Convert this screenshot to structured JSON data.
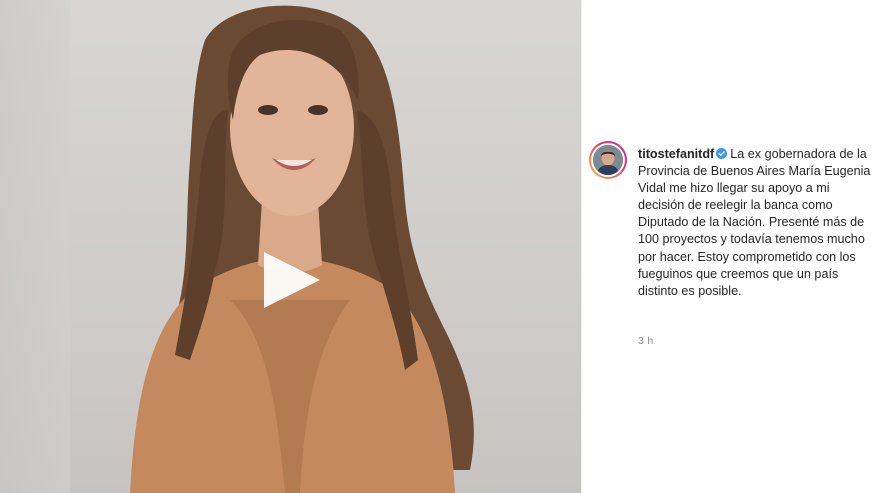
{
  "post": {
    "username": "titostefanitdf",
    "caption": "La ex gobernadora de la Provincia de Buenos Aires María Eugenia Vidal me hizo llegar su apoyo a mi decisión de reelegir la banca como Diputado de la Nación. Presenté más de 100 proyectos y todavía tenemos mucho por hacer. Estoy comprometido con los fueguinos que creemos que un país distinto es posible.",
    "time": "3 h"
  },
  "icons": {
    "play": "play-icon",
    "verified": "verified-badge-icon",
    "verified_color": "#3897f0"
  }
}
